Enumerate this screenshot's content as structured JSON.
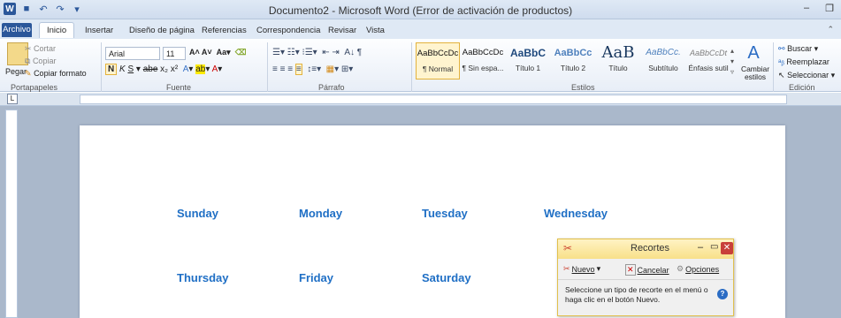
{
  "window": {
    "title": "Documento2 - Microsoft Word (Error de activación de productos)"
  },
  "tabs": [
    "Archivo",
    "Inicio",
    "Insertar",
    "Diseño de página",
    "Referencias",
    "Correspondencia",
    "Revisar",
    "Vista"
  ],
  "clipboard": {
    "paste": "Pegar",
    "cut": "Cortar",
    "copy": "Copiar",
    "format_painter": "Copiar formato",
    "group": "Portapapeles"
  },
  "font": {
    "name": "Arial",
    "size": "11",
    "group": "Fuente"
  },
  "paragraph": {
    "group": "Párrafo"
  },
  "styles": {
    "items": [
      {
        "preview": "AaBbCcDc",
        "name": "¶ Normal"
      },
      {
        "preview": "AaBbCcDc",
        "name": "¶ Sin espa..."
      },
      {
        "preview": "AaBbC",
        "name": "Título 1"
      },
      {
        "preview": "AaBbCc",
        "name": "Título 2"
      },
      {
        "preview": "AaB",
        "name": "Título"
      },
      {
        "preview": "AaBbCc.",
        "name": "Subtítulo"
      },
      {
        "preview": "AaBbCcDt",
        "name": "Énfasis sutil"
      }
    ],
    "change": "Cambiar estilos",
    "group": "Estilos"
  },
  "editing": {
    "find": "Buscar",
    "replace": "Reemplazar",
    "select": "Seleccionar",
    "group": "Edición"
  },
  "document": {
    "days": [
      "Sunday",
      "Monday",
      "Tuesday",
      "Wednesday",
      "Thursday",
      "Friday",
      "Saturday"
    ]
  },
  "snipping": {
    "title": "Recortes",
    "new": "Nuevo",
    "cancel": "Cancelar",
    "options": "Opciones",
    "message": "Seleccione un tipo de recorte en el menú o haga clic en el botón Nuevo."
  },
  "colors": {
    "accent": "#2b579a",
    "day_text": "#1f6fc5",
    "snip_border": "#e1c04c"
  }
}
